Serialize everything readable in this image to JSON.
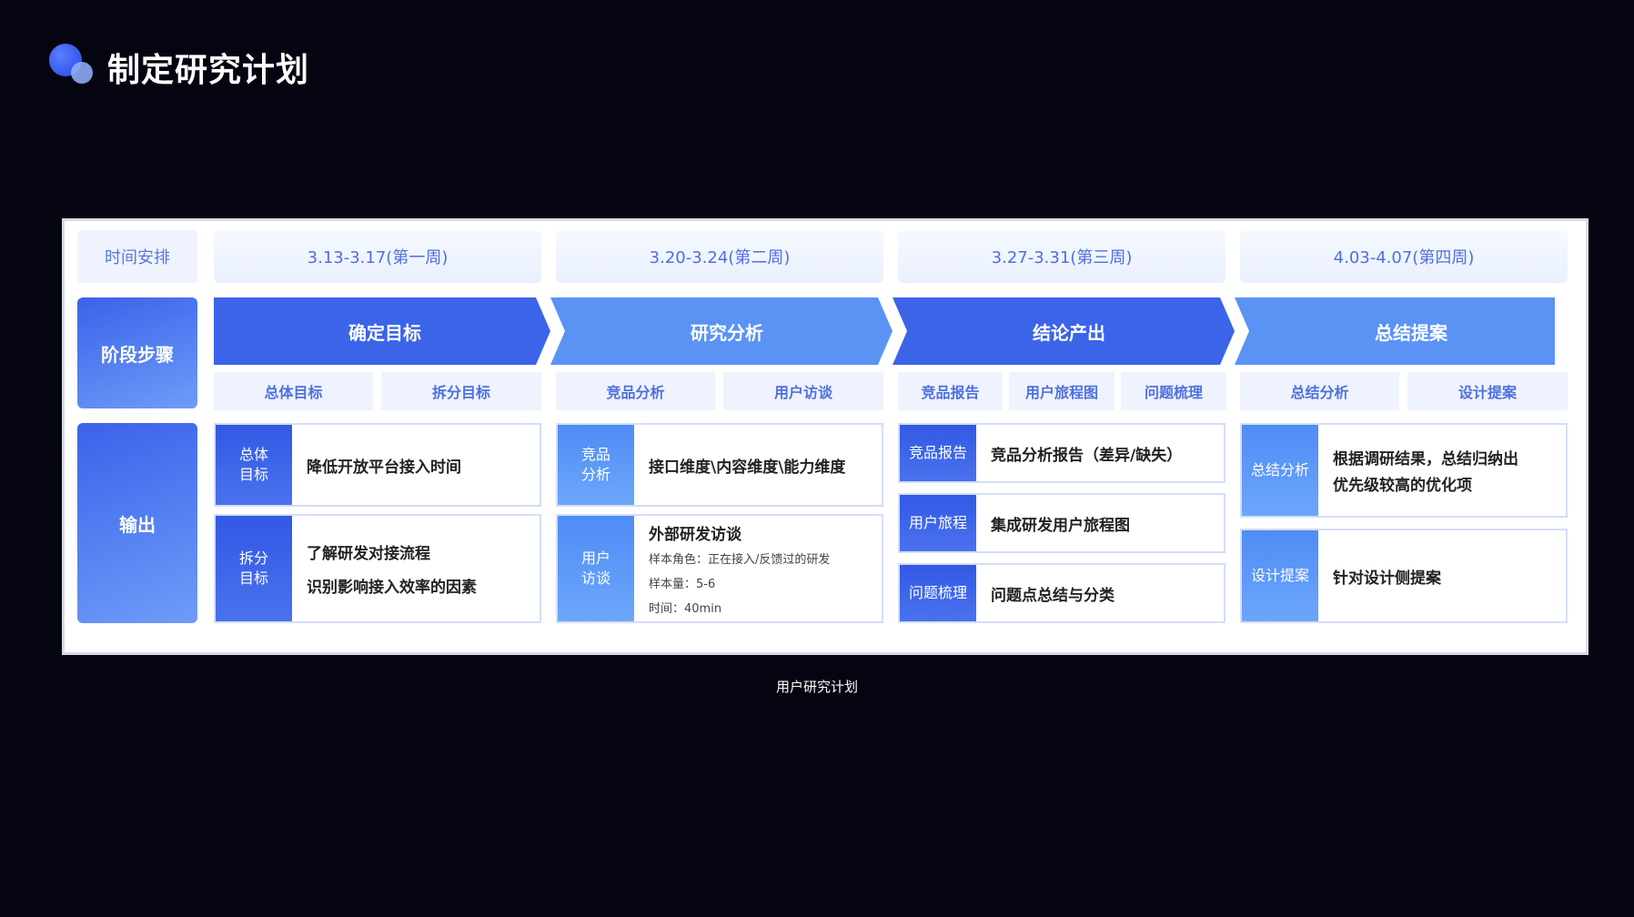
{
  "title": "制定研究计划",
  "caption": "用户研究计划",
  "row_labels": {
    "time": "时间安排",
    "stage": "阶段步骤",
    "output": "输出"
  },
  "weeks": [
    "3.13-3.17(第一周)",
    "3.20-3.24(第二周)",
    "3.27-3.31(第三周)",
    "4.03-4.07(第四周)"
  ],
  "stages": [
    {
      "name": "确定目标",
      "color": "#3b64e8"
    },
    {
      "name": "研究分析",
      "color": "#5a93f4"
    },
    {
      "name": "结论产出",
      "color": "#3b64e8"
    },
    {
      "name": "总结提案",
      "color": "#5a93f4"
    }
  ],
  "substeps": [
    [
      "总体目标",
      "拆分目标"
    ],
    [
      "竞品分析",
      "用户访谈"
    ],
    [
      "竞品报告",
      "用户旅程图",
      "问题梳理"
    ],
    [
      "总结分析",
      "设计提案"
    ]
  ],
  "outputs": {
    "col1": {
      "a": {
        "tag1": "总体",
        "tag2": "目标",
        "text": "降低开放平台接入时间"
      },
      "b": {
        "tag1": "拆分",
        "tag2": "目标",
        "line1": "了解研发对接流程",
        "line2": "识别影响接入效率的因素"
      }
    },
    "col2": {
      "a": {
        "tag1": "竞品",
        "tag2": "分析",
        "text": "接口维度\\内容维度\\能力维度"
      },
      "b": {
        "tag1": "用户",
        "tag2": "访谈",
        "title": "外部研发访谈",
        "d1": "样本角色：正在接入/反馈过的研发",
        "d2": "样本量：5-6",
        "d3": "时间：40min"
      }
    },
    "col3": {
      "a": {
        "tag": "竞品报告",
        "text": "竞品分析报告（差异/缺失）"
      },
      "b": {
        "tag": "用户旅程",
        "text": "集成研发用户旅程图"
      },
      "c": {
        "tag": "问题梳理",
        "text": "问题点总结与分类"
      }
    },
    "col4": {
      "a": {
        "tag": "总结分析",
        "line1": "根据调研结果，总结归纳出",
        "line2": "优先级较高的优化项"
      },
      "b": {
        "tag": "设计提案",
        "text": "针对设计侧提案"
      }
    }
  }
}
